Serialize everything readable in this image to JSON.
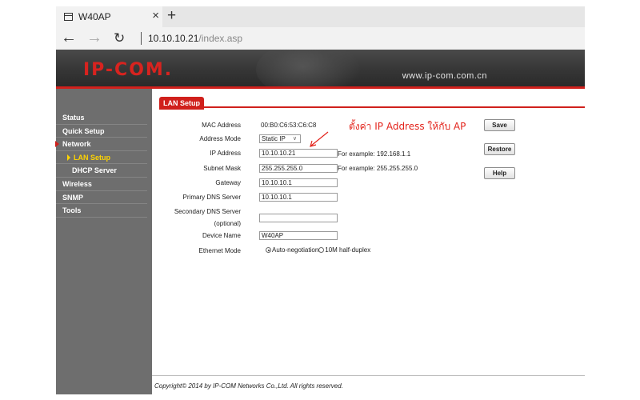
{
  "browser": {
    "tab_title": "W40AP",
    "close_glyph": "×",
    "new_tab_glyph": "+",
    "back_glyph": "←",
    "forward_glyph": "→",
    "refresh_glyph": "↻",
    "url_host": "10.10.10.21",
    "url_path": "/index.asp"
  },
  "banner": {
    "logo": "IP-COM",
    "logo_dot": ".",
    "site_url": "www.ip-com.com.cn"
  },
  "sidebar": {
    "items": [
      {
        "label": "Status"
      },
      {
        "label": "Quick Setup"
      },
      {
        "label": "Network"
      },
      {
        "label": "LAN Setup"
      },
      {
        "label": "DHCP Server"
      },
      {
        "label": "Wireless"
      },
      {
        "label": "SNMP"
      },
      {
        "label": "Tools"
      }
    ]
  },
  "main": {
    "tab_label": "LAN Setup",
    "annotation": "ตั้งค่า IP Address ให้กับ AP",
    "mac": {
      "label": "MAC Address",
      "value": "00:B0:C6:53:C6:C8"
    },
    "address_mode": {
      "label": "Address Mode",
      "value": "Static IP"
    },
    "ip": {
      "label": "IP Address",
      "value": "10.10.10.21",
      "hint": "For example: 192.168.1.1"
    },
    "subnet": {
      "label": "Subnet Mask",
      "value": "255.255.255.0",
      "hint": "For example: 255.255.255.0"
    },
    "gateway": {
      "label": "Gateway",
      "value": "10.10.10.1"
    },
    "primary_dns": {
      "label": "Primary DNS Server",
      "value": "10.10.10.1"
    },
    "secondary_dns": {
      "label": "Secondary DNS Server",
      "label2": "(optional)",
      "value": ""
    },
    "device_name": {
      "label": "Device Name",
      "value": "W40AP"
    },
    "ethernet_mode": {
      "label": "Ethernet Mode",
      "option1": "Auto-negotiation",
      "option2": "10M half-duplex",
      "selected": "Auto-negotiation"
    },
    "buttons": {
      "save": "Save",
      "restore": "Restore",
      "help": "Help"
    }
  },
  "footer": {
    "copyright": "Copyright© 2014 by IP-COM Networks Co.,Ltd. All rights reserved."
  },
  "colors": {
    "accent_red": "#d0201c",
    "sidebar_bg": "#6e6e6e",
    "active_menu": "#ffd400",
    "annotation": "#e3241c"
  }
}
